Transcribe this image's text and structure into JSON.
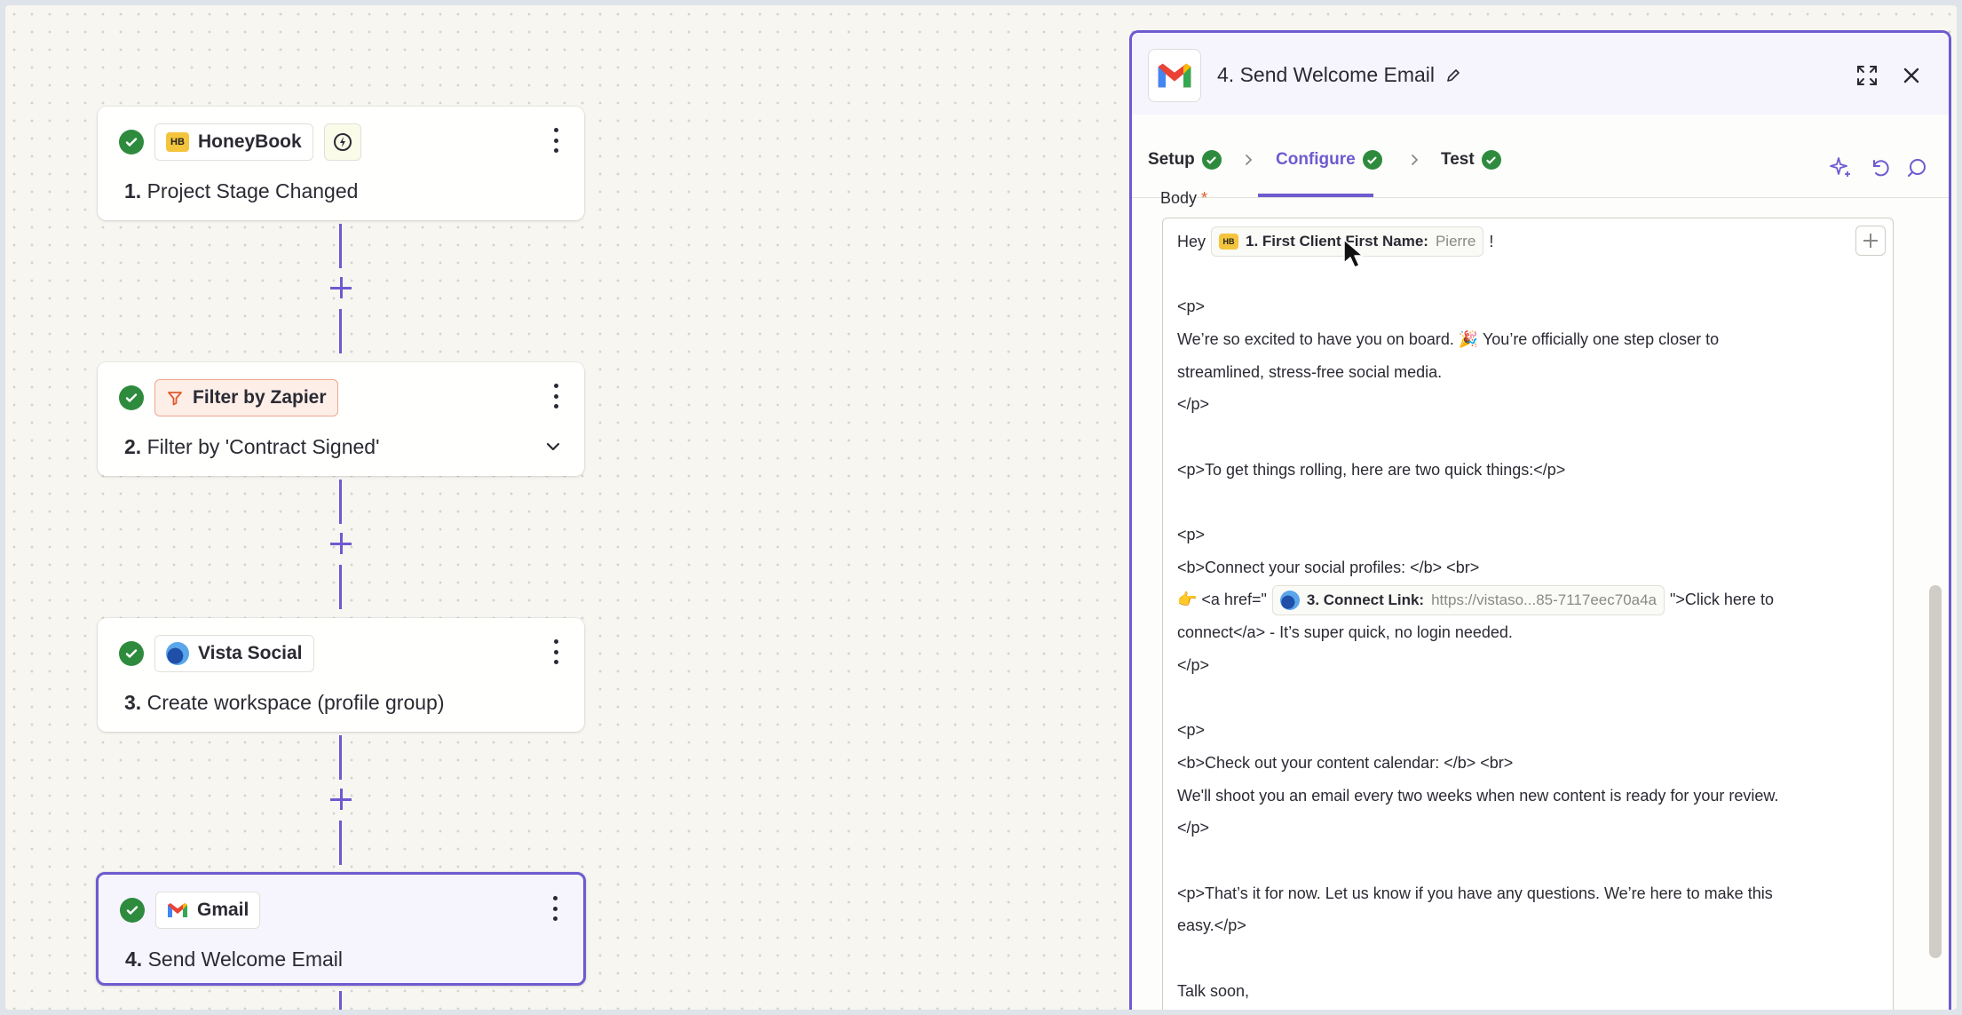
{
  "canvas": {
    "nodes": [
      {
        "app": "HoneyBook",
        "step": "1.",
        "title": "Project Stage Changed"
      },
      {
        "app": "Filter by Zapier",
        "step": "2.",
        "title": "Filter by 'Contract Signed'"
      },
      {
        "app": "Vista Social",
        "step": "3.",
        "title": "Create workspace (profile group)"
      },
      {
        "app": "Gmail",
        "step": "4.",
        "title": "Send Welcome Email"
      }
    ]
  },
  "panel": {
    "title": "4. Send Welcome Email",
    "tabs": [
      "Setup",
      "Configure",
      "Test"
    ],
    "active_tab": "Configure",
    "field_label": "Body",
    "field_required": "*",
    "body": {
      "greeting": "Hey",
      "greeting_end": "!",
      "pill1_label": "1. First Client First Name:",
      "pill1_value": "Pierre",
      "lines": [
        "",
        "<p>",
        "We’re so excited to have you on board. 🎉 You’re officially one step closer to",
        "streamlined, stress-free social media.",
        "</p>",
        "",
        "<p>To get things rolling, here are two quick things:</p>",
        "",
        "<p>",
        "<b>Connect your social profiles: </b> <br>"
      ],
      "link_prefix": "👉 <a href=\"",
      "pill2_label": "3. Connect Link:",
      "pill2_value": "https://vistaso...85-7117eec70a4a",
      "link_suffix": "\">Click here to",
      "lines2": [
        "connect</a> - It’s super quick, no login needed.",
        "</p>",
        "",
        "<p>",
        "<b>Check out your content calendar: </b> <br>",
        "We'll shoot you an email every two weeks when new content is ready for your review.",
        "</p>",
        "",
        "<p>That’s it for now. Let us know if you have any questions. We’re here to make this",
        "easy.</p>",
        "",
        "Talk soon,"
      ]
    }
  },
  "colors": {
    "accent": "#6d5bd0",
    "success": "#2e8b3e",
    "required": "#e05a2b"
  }
}
